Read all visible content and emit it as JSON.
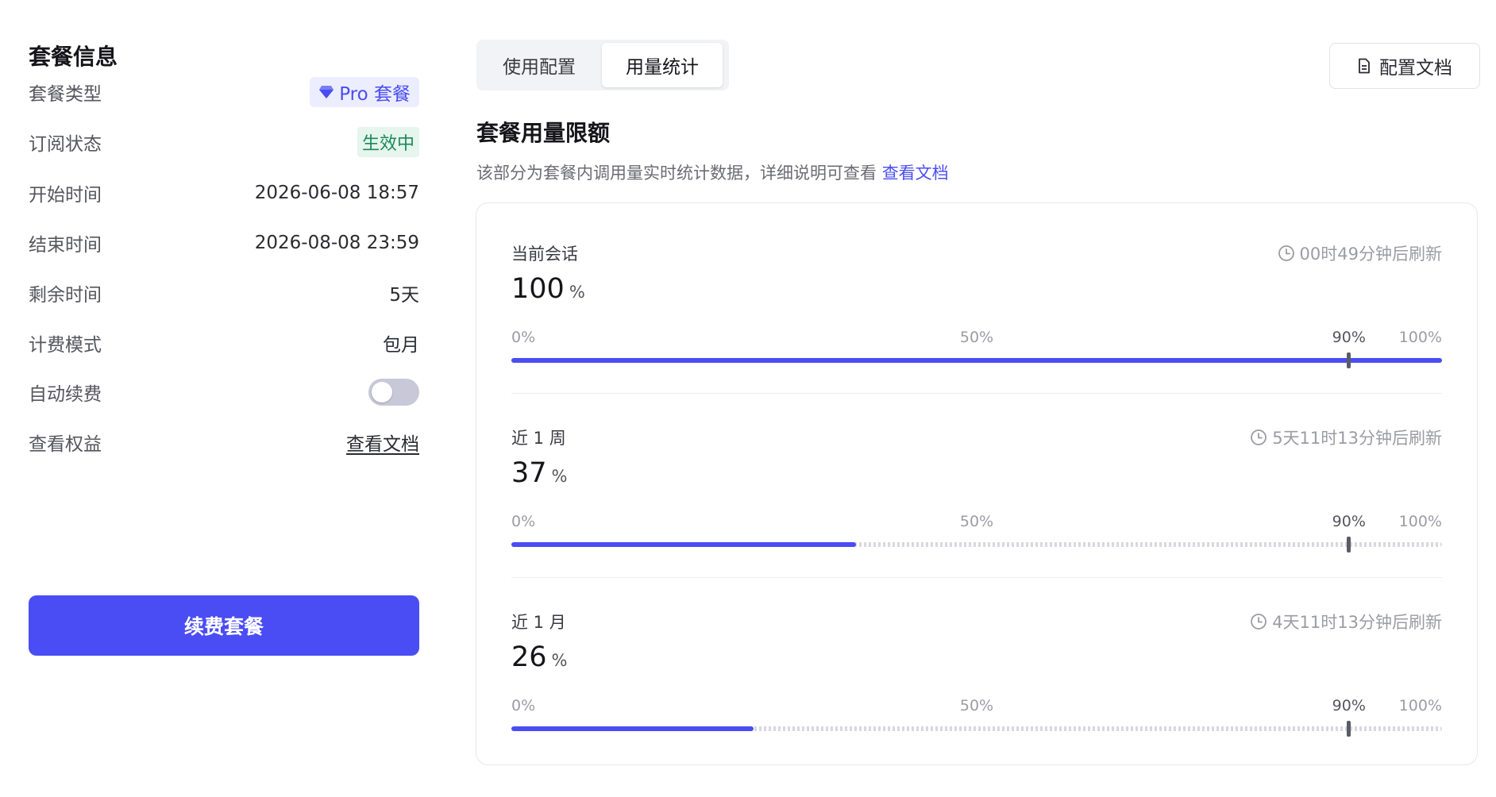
{
  "plan": {
    "title": "套餐信息",
    "rows": [
      {
        "label": "套餐类型",
        "value": "Pro 套餐"
      },
      {
        "label": "订阅状态",
        "value": "生效中"
      },
      {
        "label": "开始时间",
        "value": "2026-06-08 18:57"
      },
      {
        "label": "结束时间",
        "value": "2026-08-08 23:59"
      },
      {
        "label": "剩余时间",
        "value": "5天"
      },
      {
        "label": "计费模式",
        "value": "包月"
      },
      {
        "label": "自动续费",
        "value": ""
      },
      {
        "label": "查看权益",
        "value": "查看文档"
      }
    ],
    "auto_renew": false,
    "renew_button": "续费套餐"
  },
  "tabs": [
    {
      "label": "使用配置",
      "active": false
    },
    {
      "label": "用量统计",
      "active": true
    }
  ],
  "doc_button": "配置文档",
  "usage": {
    "title": "套餐用量限额",
    "desc": "该部分为套餐内调用量实时统计数据，详细说明可查看",
    "desc_link": "查看文档",
    "ticks": [
      "0%",
      "50%",
      "90%",
      "100%"
    ],
    "unit": "%",
    "items": [
      {
        "title": "当前会话",
        "value": 100,
        "refresh": "00时49分钟后刷新"
      },
      {
        "title": "近 1 周",
        "value": 37,
        "refresh": "5天11时13分钟后刷新"
      },
      {
        "title": "近 1 月",
        "value": 26,
        "refresh": "4天11时13分钟后刷新"
      }
    ],
    "marker": 90
  },
  "colors": {
    "accent": "#4a4df3",
    "active_green": "#1a8a55"
  }
}
